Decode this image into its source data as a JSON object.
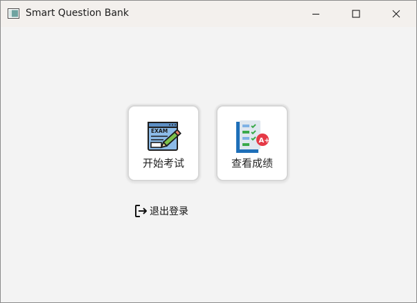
{
  "window": {
    "title": "Smart Question Bank",
    "app_icon": "window-app-icon",
    "controls": {
      "minimize_icon": "minimize-icon",
      "maximize_icon": "maximize-icon",
      "close_icon": "close-icon"
    }
  },
  "main": {
    "tiles": [
      {
        "label": "开始考试",
        "icon": "exam-paper-icon",
        "icon_text": "EXAM"
      },
      {
        "label": "查看成绩",
        "icon": "grade-report-icon",
        "icon_text": "A+"
      }
    ],
    "logout": {
      "label": "退出登录",
      "icon": "logout-icon"
    }
  },
  "colors": {
    "background": "#f3f3f3",
    "titlebar": "#f3f0ed",
    "tile_background": "#ffffff",
    "tile_border": "#d6d6d6",
    "exam_icon_blue": "#7fb2e5",
    "grade_icon_blue": "#1e6fb8",
    "grade_badge_red": "#e53946",
    "check_green": "#3aa94a"
  }
}
